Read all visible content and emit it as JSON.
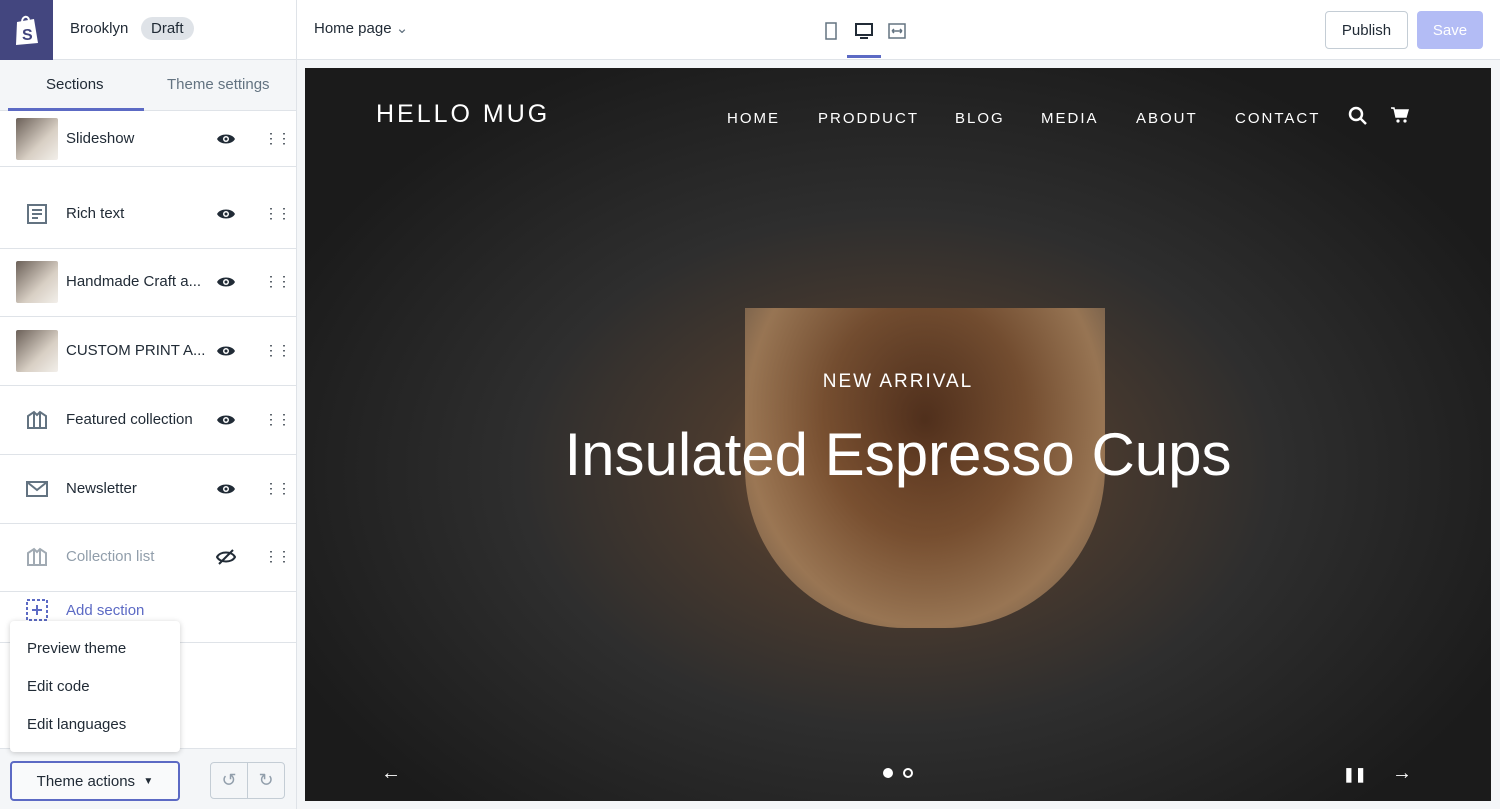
{
  "header": {
    "store": "Brooklyn",
    "status": "Draft",
    "page": "Home page",
    "publish": "Publish",
    "save": "Save"
  },
  "sidebar": {
    "tabs": [
      "Sections",
      "Theme settings"
    ],
    "items": [
      {
        "label": "Slideshow",
        "type": "thumb",
        "visible": true
      },
      {
        "label": "Rich text",
        "type": "text-icon",
        "visible": true
      },
      {
        "label": "Handmade Craft a...",
        "type": "thumb",
        "visible": true
      },
      {
        "label": "CUSTOM PRINT A...",
        "type": "thumb",
        "visible": true
      },
      {
        "label": "Featured collection",
        "type": "collection-icon",
        "visible": true
      },
      {
        "label": "Newsletter",
        "type": "mail-icon",
        "visible": true
      },
      {
        "label": "Collection list",
        "type": "collection-icon",
        "visible": false
      }
    ],
    "add_section": "Add section",
    "menu": [
      "Preview theme",
      "Edit code",
      "Edit languages"
    ],
    "theme_actions": "Theme actions"
  },
  "preview": {
    "brand": "HELLO MUG",
    "nav": [
      "HOME",
      "PRODDUCT",
      "BLOG",
      "MEDIA",
      "ABOUT",
      "CONTACT"
    ],
    "subtitle": "NEW ARRIVAL",
    "title": "Insulated Espresso Cups"
  },
  "colors": {
    "accent": "#5c6ac4",
    "logo_bg": "#43467f"
  }
}
